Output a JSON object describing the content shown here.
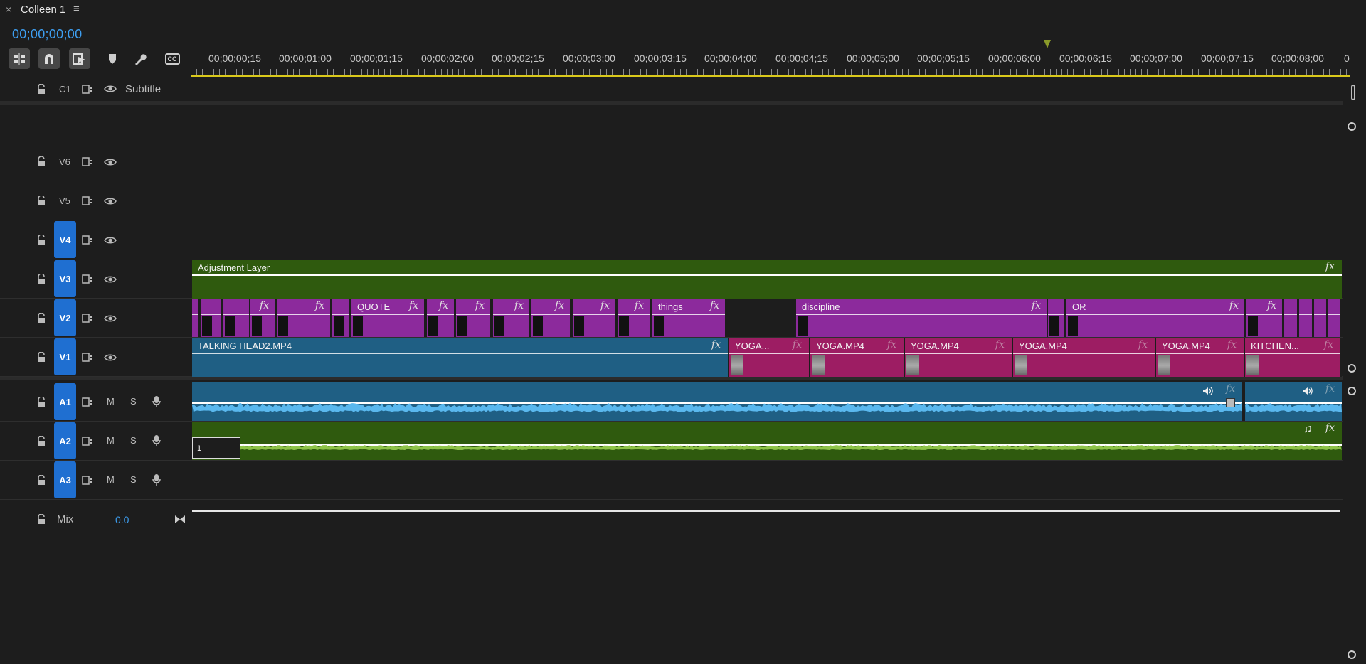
{
  "panel": {
    "close_label": "×",
    "title": "Colleen 1",
    "menu_icon": "menu-icon"
  },
  "timecode": "00;00;00;00",
  "toolbar": {
    "tools": [
      "nest-sequence-icon",
      "snap-magnet-icon",
      "linked-selection-icon",
      "add-marker-icon",
      "wrench-settings-icon",
      "captions-cc-icon"
    ],
    "cc_label": "CC"
  },
  "ruler": {
    "labels": [
      "00;00;00;15",
      "00;00;01;00",
      "00;00;01;15",
      "00;00;02;00",
      "00;00;02;15",
      "00;00;03;00",
      "00;00;03;15",
      "00;00;04;00",
      "00;00;04;15",
      "00;00;05;00",
      "00;00;05;15",
      "00;00;06;00",
      "00;00;06;15",
      "00;00;07;00",
      "00;00;07;15",
      "00;00;08;00",
      "0"
    ]
  },
  "tracks": {
    "subtitle": {
      "id": "C1",
      "name": "Subtitle"
    },
    "video": [
      {
        "id": "V6",
        "targeted": false
      },
      {
        "id": "V5",
        "targeted": false
      },
      {
        "id": "V4",
        "targeted": true
      },
      {
        "id": "V3",
        "targeted": true
      },
      {
        "id": "V2",
        "targeted": true
      },
      {
        "id": "V1",
        "targeted": true
      }
    ],
    "audio": [
      {
        "id": "A1",
        "mute": "M",
        "solo": "S"
      },
      {
        "id": "A2",
        "mute": "M",
        "solo": "S"
      },
      {
        "id": "A3",
        "mute": "M",
        "solo": "S"
      }
    ],
    "mix": {
      "name": "Mix",
      "value": "0.0"
    }
  },
  "clips": {
    "adjustment": {
      "label": "Adjustment Layer",
      "fx": "fx"
    },
    "v2_labels": {
      "quote": "QUOTE",
      "things": "things",
      "discipline": "discipline",
      "or": "OR"
    },
    "v1": {
      "talking_head": "TALKING HEAD2.MP4",
      "yoga_short": "YOGA...",
      "yoga": "YOGA.MP4",
      "kitchen": "KITCHEN..."
    },
    "fx": "fx",
    "a2_keyframe_label": "1"
  },
  "colors": {
    "accent_blue": "#1f6fd1",
    "timecode_blue": "#3d9ef0",
    "adjustment_green": "#2f5a0e",
    "graphics_purple": "#8c2a9c",
    "video_magenta": "#9d1d63",
    "talking_head_teal": "#1f5f84",
    "audio_blue": "#1f5f84",
    "audio_green": "#2f5a0e",
    "work_area_yellow": "#d9c81a"
  }
}
